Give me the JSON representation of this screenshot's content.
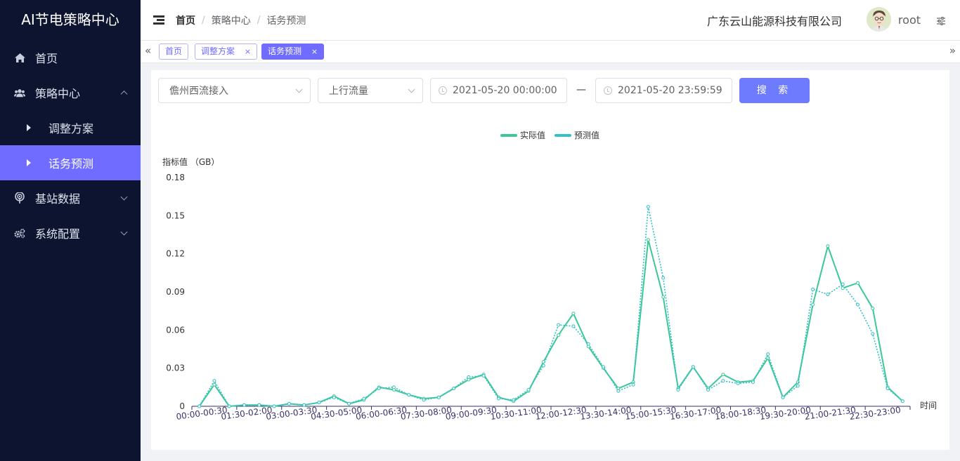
{
  "sidebar": {
    "title": "AI节电策略中心",
    "items": [
      {
        "label": "首页",
        "icon": "home-icon"
      },
      {
        "label": "策略中心",
        "icon": "users-icon"
      },
      {
        "label": "调整方案"
      },
      {
        "label": "话务预测"
      },
      {
        "label": "基站数据",
        "icon": "signal-icon"
      },
      {
        "label": "系统配置",
        "icon": "gears-icon"
      }
    ],
    "active_color": "#6f6cff"
  },
  "header": {
    "breadcrumb": [
      "首页",
      "策略中心",
      "话务预测"
    ],
    "company": "广东云山能源科技有限公司",
    "username": "root"
  },
  "tags": {
    "items": [
      {
        "label": "首页"
      },
      {
        "label": "调整方案",
        "close": "×"
      },
      {
        "label": "话务预测",
        "close": "×"
      }
    ],
    "left_arrow": "«",
    "right_arrow": "»"
  },
  "filters": {
    "site": "儋州西流接入",
    "metric": "上行流量",
    "start": "2021-05-20 00:00:00",
    "end": "2021-05-20 23:59:59",
    "range_sep": "—",
    "search_label": "搜 索"
  },
  "chart_data": {
    "type": "line",
    "title": "",
    "ylabel": "指标值 （GB）",
    "xlabel": "时间",
    "ylim": [
      0,
      0.18
    ],
    "yticks": [
      "0",
      "0.03",
      "0.06",
      "0.09",
      "0.12",
      "0.15",
      "0.18"
    ],
    "xtick_labels": [
      "00:00-00:30",
      "01:30-02:00",
      "03:00-03:30",
      "04:30-05:00",
      "06:00-06:30",
      "07:30-08:00",
      "09:00-09:30",
      "10:30-11:00",
      "12:00-12:30",
      "13:30-14:00",
      "15:00-15:30",
      "16:30-17:00",
      "18:00-18:30",
      "19:30-20:00",
      "21:00-21:30",
      "22:30-23:00"
    ],
    "legend": [
      "实际值",
      "预测值"
    ],
    "grid": false,
    "n_points": 48,
    "series": [
      {
        "name": "实际值",
        "color": "#3cc896",
        "style": "solid",
        "values": [
          0,
          0.017,
          0,
          0.001,
          0.001,
          0,
          0.002,
          0.001,
          0.003,
          0.008,
          0.002,
          0.005,
          0.015,
          0.013,
          0.009,
          0.006,
          0.007,
          0.014,
          0.021,
          0.025,
          0.007,
          0.004,
          0.012,
          0.035,
          0.056,
          0.073,
          0.047,
          0.03,
          0.014,
          0.019,
          0.131,
          0.086,
          0.014,
          0.031,
          0.014,
          0.025,
          0.019,
          0.02,
          0.038,
          0.007,
          0.019,
          0.08,
          0.126,
          0.093,
          0.097,
          0.077,
          0.015,
          0.004
        ]
      },
      {
        "name": "预测值",
        "color": "#30c2c8",
        "style": "dotted",
        "values": [
          0,
          0.02,
          0,
          0.001,
          0.001,
          0,
          0.002,
          0.001,
          0.003,
          0.007,
          0.002,
          0.006,
          0.014,
          0.015,
          0.009,
          0.005,
          0.007,
          0.014,
          0.023,
          0.024,
          0.006,
          0.005,
          0.013,
          0.032,
          0.064,
          0.063,
          0.049,
          0.031,
          0.012,
          0.017,
          0.157,
          0.101,
          0.013,
          0.031,
          0.013,
          0.02,
          0.018,
          0.019,
          0.041,
          0.007,
          0.016,
          0.092,
          0.088,
          0.096,
          0.08,
          0.057,
          0.014,
          0.004
        ]
      }
    ]
  }
}
